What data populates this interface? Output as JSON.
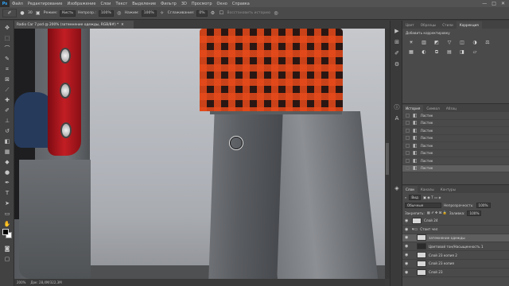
{
  "menubar": {
    "logo": "Ps",
    "items": [
      "Файл",
      "Редактирование",
      "Изображение",
      "Слои",
      "Текст",
      "Выделение",
      "Фильтр",
      "3D",
      "Просмотр",
      "Окно",
      "Справка"
    ],
    "controls": [
      "—",
      "□",
      "✕"
    ]
  },
  "options": {
    "size": "30",
    "mode_label": "Режим:",
    "mode_value": "Кисть",
    "opacity_label": "Непрозр.:",
    "opacity_value": "100%",
    "flow_label": "Нажим:",
    "flow_value": "100%",
    "smoothing_label": "Сглаживание:",
    "smoothing_value": "0%",
    "history_label": "Восстановить историю"
  },
  "document": {
    "tab_title": "Radio Car 7.psd @ 200% (затемнение одежды, RGB/8#) *",
    "status": [
      "200%",
      "Док: 28,4M/322,3M"
    ]
  },
  "panels": {
    "top_tabs": [
      "Цвет",
      "Образцы",
      "Стили",
      "Коррекция"
    ],
    "adjust_title": "Добавить корректировку",
    "adjust_icons": [
      "☀",
      "▥",
      "◩",
      "▽",
      "◫",
      "◑",
      "⚖",
      "▦",
      "◐",
      "⧉",
      "▤",
      "◨",
      "▱"
    ],
    "history_tabs": [
      "История",
      "Символ",
      "Абзац"
    ],
    "history_items": [
      "Ластик",
      "Ластик",
      "Ластик",
      "Ластик",
      "Ластик",
      "Ластик",
      "Ластик",
      "Ластик"
    ],
    "layers_tabs": [
      "Слои",
      "Каналы",
      "Контуры"
    ],
    "kind_filter": "Вид",
    "blend_mode": "Обычные",
    "opacity_label": "Непрозрачность:",
    "opacity_value": "100%",
    "lock_label": "Закрепить:",
    "fill_label": "Заливка:",
    "fill_value": "100%",
    "layers": [
      {
        "name": "Слой 24",
        "kind": "layer"
      },
      {
        "name": "Стоит чел",
        "kind": "group"
      },
      {
        "name": "затемнение одежды",
        "kind": "layer"
      },
      {
        "name": "Цветовой тон/Насыщенность 1",
        "kind": "adjustment"
      },
      {
        "name": "Слой 23 копия 2",
        "kind": "layer"
      },
      {
        "name": "Слой 23 копия",
        "kind": "layer"
      },
      {
        "name": "Слой 23",
        "kind": "layer"
      }
    ]
  }
}
